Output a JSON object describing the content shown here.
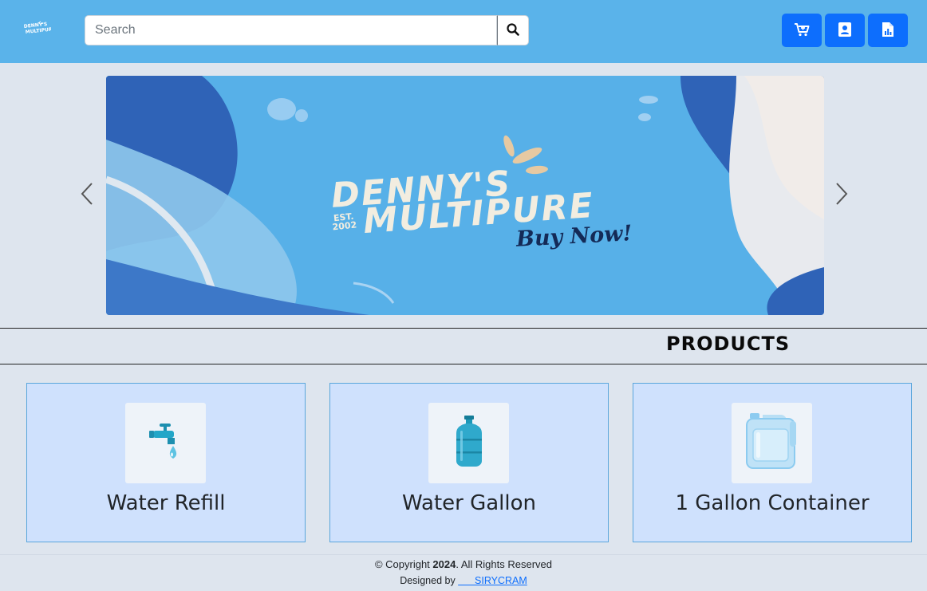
{
  "header": {
    "logo_alt": "Denny's Multipure",
    "search": {
      "placeholder": "Search",
      "value": ""
    },
    "search_button_icon": "search-icon",
    "buttons": [
      {
        "name": "cart",
        "icon": "cart-plus-icon"
      },
      {
        "name": "account",
        "icon": "user-badge-icon"
      },
      {
        "name": "report",
        "icon": "file-chart-icon"
      }
    ],
    "accent_color": "#0d6efd",
    "bar_color": "#5ab3ea"
  },
  "banner": {
    "brand_line1": "DENNY'S",
    "brand_line2": "MULTIPURE",
    "est_line1": "EST.",
    "est_line2": "2002",
    "cta": "Buy Now!",
    "prev_icon": "chevron-left-icon",
    "next_icon": "chevron-right-icon"
  },
  "products": {
    "heading": "PRODUCTS",
    "items": [
      {
        "title": "Water Refill",
        "icon": "faucet-icon"
      },
      {
        "title": "Water Gallon",
        "icon": "water-jug-icon"
      },
      {
        "title": "1 Gallon Container",
        "icon": "gallon-container-icon"
      }
    ]
  },
  "footer": {
    "copyright_prefix": "© Copyright ",
    "year": "2024",
    "copyright_suffix": ". All Rights Reserved",
    "designed_by": "Designed by ",
    "designer_link": "SIRYCRAM"
  }
}
